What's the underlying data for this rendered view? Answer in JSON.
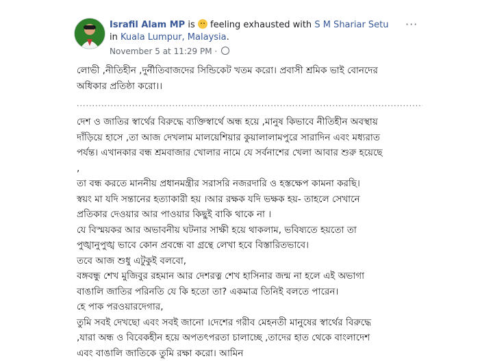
{
  "post": {
    "author": "Israfil Alam MP",
    "is_text": "is",
    "feeling": "feeling exhausted with",
    "with_person": "S M Shariar Setu",
    "in_text": "in",
    "location": "Kuala Lumpur, Malaysia",
    "location_end": ".",
    "timestamp": "November 5 at 11:29 PM",
    "separator": "·",
    "more_icon": "···",
    "lines": [
      "লোভী ,নীতিহীন ,দুর্নীতিবাজদের সিন্ডিকেট খতম করো। প্রবাসী শ্রমিক ভাই বোনদের",
      "অধিকার প্রতিষ্ঠা করো।।",
      "",
      "দেশ ও জাতির স্বার্থের বিরুদ্ধে ব্যক্তিস্বার্থে অন্ধ হয়ে ,মানুষ কিভাবে নীতিহীন অবস্থায়",
      "দাঁড়িয়ে হাসে ,তা আজ দেখলাম মালয়েশিয়ার কুয়ালালামপুরে সারাদিন এবং মধ্যরাত",
      "পর্যন্ত। এখানকার বন্ধ শ্রমবাজার খোলার নামে যে সর্বনাশের খেলা আবার শুরু হয়েছে",
      ",",
      "তা বন্ধ করতে মাননীয় প্রধানমন্ত্রীর সরাসরি নজরদারি ও হস্তক্ষেপ কামনা করছি।",
      "স্বয়ং মা যদি সন্তানের হত্যাকারী হয় ।আর রক্ষক যদি ভক্ষক হয়- তাহলে সেখানে",
      "প্রতিকার দেওয়ার আর পাওয়ার কিছুই বাকি থাকে না ।",
      "যে বিস্ময়কর আর অভাবনীয় ঘটনার সাক্ষী হয়ে থাকলাম, ভবিষ্যতে হয়তো তা",
      "পুঙ্খানুপুঙ্খ ভাবে কোন প্রবন্ধে বা গ্রন্থে লেখা হবে বিস্তারিতভাবে।",
      "তবে আজ শুধু এটুকুই বলবো,",
      "বঙ্গবন্ধু শেখ মুজিবুর রহমান আর দেশরত্ন শেখ হাসিনার জন্ম না হলে এই অভাগা",
      "বাঙালি জাতির পরিনতি যে কি হতো তা? একমাত্র তিনিই বলতে পারেন।",
      "হে পাক পরওয়ারদেগার,",
      "তুমি সবই দেখছো এবং সবই জানো ।দেশের গরীব মেহনতী মানুষের স্বার্থের বিরুদ্ধে",
      ",যারা অন্ধ ও বিবেকহীন হয়ে অপতৎপরতা চালাচ্ছে ,তাদের হাত থেকে বাংলাদেশ",
      "এবং বাঙালি জাতিকে তুমি রক্ষা করো। আমিন"
    ]
  }
}
